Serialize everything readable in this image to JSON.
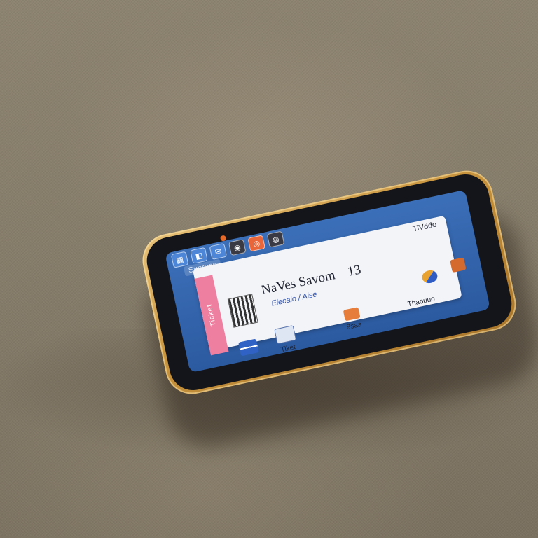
{
  "screen": {
    "title_bar": "Sunroos",
    "status_right": "TiVddo",
    "status_num": "13",
    "pink_tab": "Ticket",
    "headline": "NaVes Savom",
    "headline_num": "13",
    "subtitle": "Elecalo / Aise",
    "tiles": [
      {
        "label": "Tiket",
        "icon": "news-icon"
      },
      {
        "label": "9saa",
        "icon": "hand-icon"
      },
      {
        "label": "",
        "icon": "orange-app-icon"
      },
      {
        "label": "Thaouuo",
        "icon": "mixed-app-icon"
      },
      {
        "label": "",
        "icon": "robot-app-icon"
      }
    ]
  },
  "colors": {
    "phone_gold": "#c9953f",
    "screen_blue": "#2c5aa0",
    "card_bg": "#f3f4f8",
    "fabric": "#867c6a"
  }
}
